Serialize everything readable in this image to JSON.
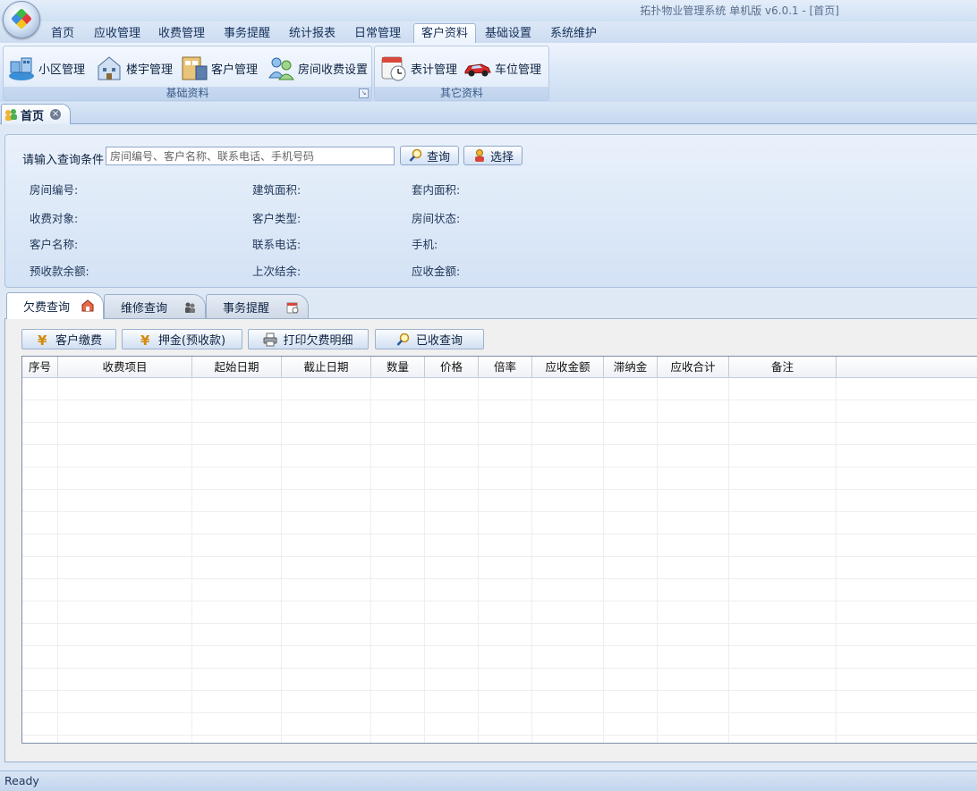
{
  "window": {
    "title": "拓扑物业管理系统  单机版 v6.0.1 - [首页]"
  },
  "menu": [
    {
      "label": "首页"
    },
    {
      "label": "应收管理"
    },
    {
      "label": "收费管理"
    },
    {
      "label": "事务提醒"
    },
    {
      "label": "统计报表"
    },
    {
      "label": "日常管理"
    },
    {
      "label": "客户资料",
      "active": true
    },
    {
      "label": "基础设置"
    },
    {
      "label": "系统维护"
    }
  ],
  "ribbon": {
    "groups": [
      {
        "label": "基础资料",
        "buttons": [
          {
            "label": "小区管理",
            "icon": "community-icon"
          },
          {
            "label": "楼宇管理",
            "icon": "building-icon"
          },
          {
            "label": "客户管理",
            "icon": "customer-icon"
          },
          {
            "label": "房间收费设置",
            "icon": "room-fee-icon"
          }
        ]
      },
      {
        "label": "其它资料",
        "buttons": [
          {
            "label": "表计管理",
            "icon": "meter-icon"
          },
          {
            "label": "车位管理",
            "icon": "car-icon"
          }
        ]
      }
    ]
  },
  "doc_tab": {
    "label": "首页"
  },
  "query": {
    "label": "请输入查询条件",
    "placeholder": "房间编号、客户名称、联系电话、手机号码",
    "search_button": "查询",
    "select_button": "选择"
  },
  "info": {
    "room_no": "房间编号:",
    "build_area": "建筑面积:",
    "inner_area": "套内面积:",
    "charge_target": "收费对象:",
    "customer_type": "客户类型:",
    "room_status": "房间状态:",
    "customer_name": "客户名称:",
    "phone": "联系电话:",
    "mobile": "手机:",
    "prepaid_balance": "预收款余额:",
    "last_balance": "上次结余:",
    "receivable": "应收金额:"
  },
  "subtabs": [
    {
      "label": "欠费查询",
      "active": true
    },
    {
      "label": "维修查询"
    },
    {
      "label": "事务提醒"
    }
  ],
  "actions": {
    "pay": "客户缴费",
    "deposit": "押金(预收款)",
    "print": "打印欠费明细",
    "paid_query": "已收查询"
  },
  "table": {
    "columns": [
      "序号",
      "收费项目",
      "起始日期",
      "截止日期",
      "数量",
      "价格",
      "倍率",
      "应收金额",
      "滞纳金",
      "应收合计",
      "备注"
    ],
    "rows": []
  },
  "status": {
    "text": "Ready"
  },
  "colors": {
    "accent": "#c9daf0",
    "panel": "#dde9f8",
    "border": "#9db4d5"
  }
}
